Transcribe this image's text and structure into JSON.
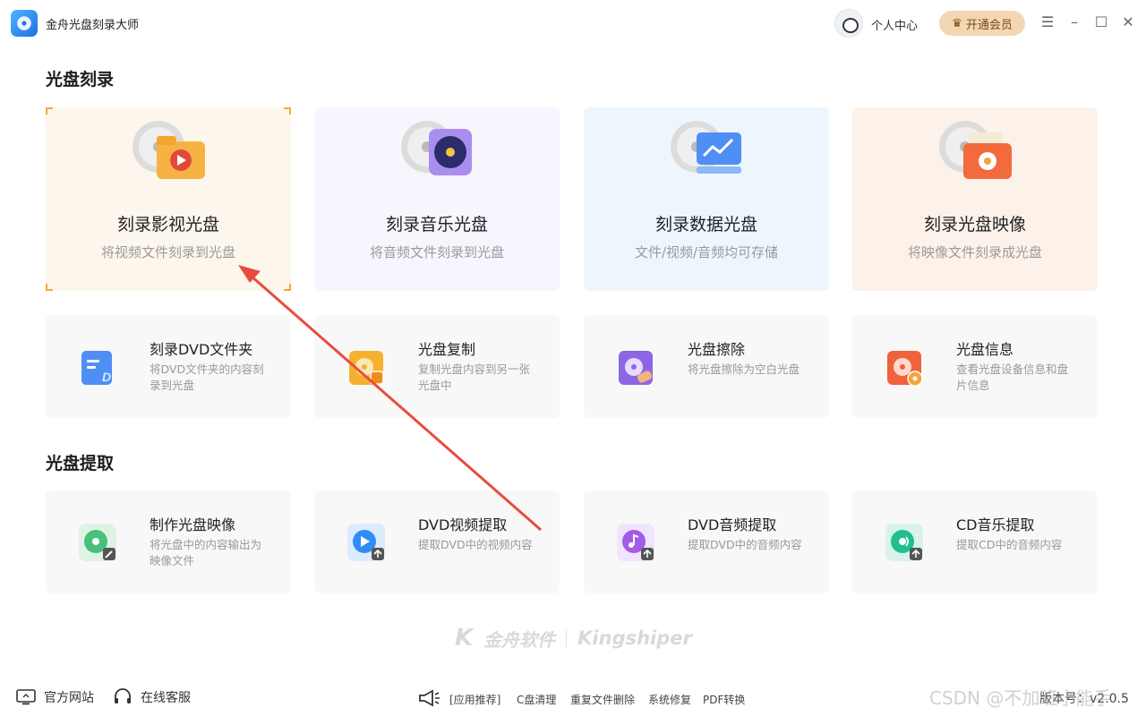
{
  "app": {
    "title": "金舟光盘刻录大师"
  },
  "header": {
    "user_center": "个人中心",
    "vip_label": "开通会员"
  },
  "sections": {
    "burn": "光盘刻录",
    "extract": "光盘提取"
  },
  "big_cards": [
    {
      "title": "刻录影视光盘",
      "sub": "将视频文件刻录到光盘"
    },
    {
      "title": "刻录音乐光盘",
      "sub": "将音频文件刻录到光盘"
    },
    {
      "title": "刻录数据光盘",
      "sub": "文件/视频/音频均可存储"
    },
    {
      "title": "刻录光盘映像",
      "sub": "将映像文件刻录成光盘"
    }
  ],
  "burn_tools": [
    {
      "title": "刻录DVD文件夹",
      "sub": "将DVD文件夹的内容刻录到光盘"
    },
    {
      "title": "光盘复制",
      "sub": "复制光盘内容到另一张光盘中"
    },
    {
      "title": "光盘擦除",
      "sub": "将光盘擦除为空白光盘"
    },
    {
      "title": "光盘信息",
      "sub": "查看光盘设备信息和盘片信息"
    }
  ],
  "extract_tools": [
    {
      "title": "制作光盘映像",
      "sub": "将光盘中的内容输出为映像文件"
    },
    {
      "title": "DVD视频提取",
      "sub": "提取DVD中的视频内容"
    },
    {
      "title": "DVD音频提取",
      "sub": "提取DVD中的音频内容"
    },
    {
      "title": "CD音乐提取",
      "sub": "提取CD中的音频内容"
    }
  ],
  "brand": {
    "cn": "金舟软件",
    "en": "Kingshiper"
  },
  "footer": {
    "website": "官方网站",
    "support": "在线客服",
    "recommend": "[应用推荐]",
    "links": [
      "C盘清理",
      "重复文件删除",
      "系统修复",
      "PDF转换"
    ],
    "version": "版本号：v2.0.5"
  },
  "overlay_watermark": "CSDN @不加班小能手",
  "colors": {
    "accent": "#f0a93a",
    "arrow": "#e84c3d",
    "vip_bg": "#f3d7b3"
  },
  "icons": [
    "disc-folder-play-icon",
    "disc-music-icon",
    "disc-data-icon",
    "disc-image-folder-icon"
  ]
}
